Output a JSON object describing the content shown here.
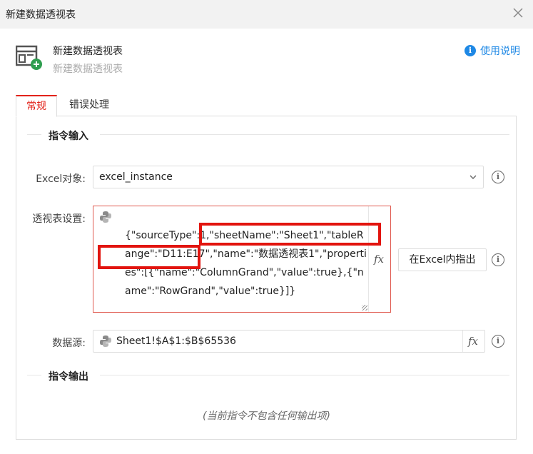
{
  "window": {
    "title": "新建数据透视表"
  },
  "header": {
    "command_title": "新建数据透视表",
    "command_subtitle": "新建数据透视表",
    "help_label": "使用说明",
    "help_icon_glyph": "i"
  },
  "tabs": [
    {
      "label": "常规",
      "active": true
    },
    {
      "label": "错误处理",
      "active": false
    }
  ],
  "sections": {
    "input_title": "指令输入",
    "output_title": "指令输出",
    "output_empty": "(当前指令不包含任何输出项)"
  },
  "fields": {
    "excel_object": {
      "label": "Excel对象:",
      "value": "excel_instance"
    },
    "pivot_settings": {
      "label": "透视表设置:",
      "value": "{\"sourceType\":1,\"sheetName\":\"Sheet1\",\"tableRange\":\"D11:E17\",\"name\":\"数据透视表1\",\"properties\":[{\"name\":\"ColumnGrand\",\"value\":true},{\"name\":\"RowGrand\",\"value\":true}]}"
    },
    "locate_button": "在Excel内指出",
    "data_source": {
      "label": "数据源:",
      "value": "Sheet1!$A$1:$B$65536"
    }
  },
  "icons": {
    "fx": "fx",
    "info": "i"
  },
  "colors": {
    "accent": "#e2231a",
    "help_blue": "#1e88e5",
    "highlight": "#e2140e",
    "field_error_border": "#e05a4f"
  }
}
